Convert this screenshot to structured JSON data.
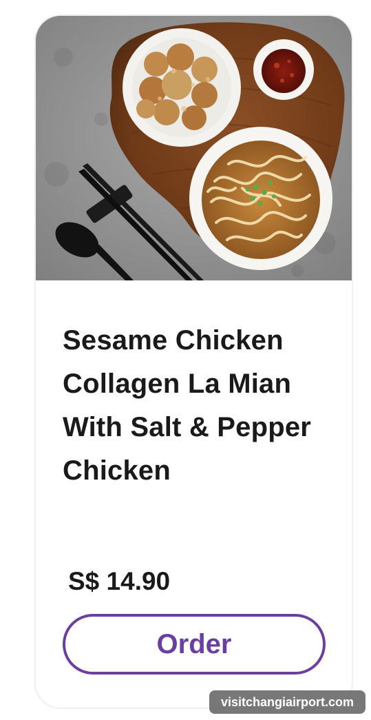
{
  "product": {
    "image_alt": "Sesame chicken collagen la mian with salt & pepper chicken",
    "title": "Sesame Chicken Collagen La Mian With Salt & Pepper Chicken",
    "price": "S$ 14.90",
    "order_label": "Order"
  },
  "watermark": {
    "text": "visitchangiairport.com"
  },
  "colors": {
    "accent": "#6b3fa0",
    "text": "#1a1a1a",
    "card_border": "#eeeef3"
  }
}
